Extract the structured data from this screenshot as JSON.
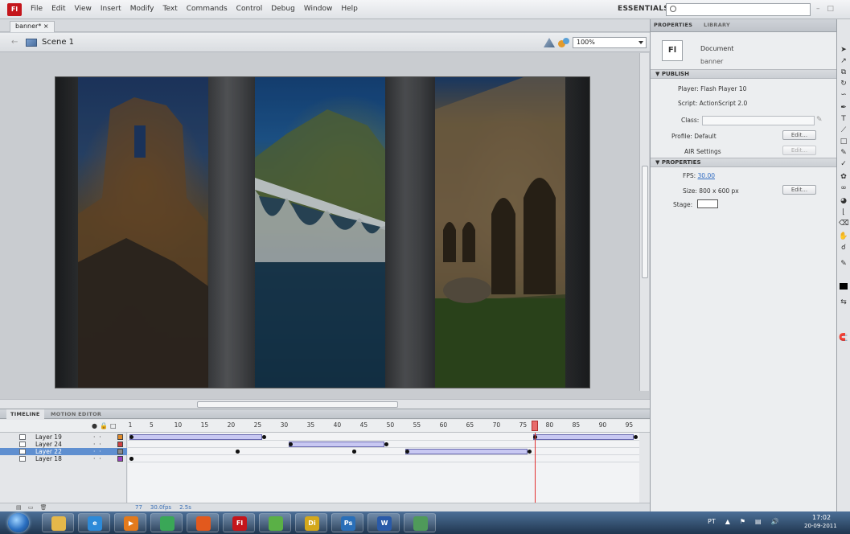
{
  "app": {
    "logo": "Fl"
  },
  "menu": [
    "File",
    "Edit",
    "View",
    "Insert",
    "Modify",
    "Text",
    "Commands",
    "Control",
    "Debug",
    "Window",
    "Help"
  ],
  "workspace": {
    "label": "ESSENTIALS ▾"
  },
  "search": {
    "placeholder": ""
  },
  "document_tab": {
    "label": "banner* ×"
  },
  "editbar": {
    "scene": "Scene 1",
    "zoom": "100%"
  },
  "stage": {
    "panels": [
      "castle ruin",
      "arch bridge over river",
      "stone abbey"
    ],
    "accent_colors": {
      "sky": "#1f5a94",
      "grass": "#2f4a22",
      "divider": "#4a4c4f"
    }
  },
  "timeline": {
    "tabs": [
      "TIMELINE",
      "MOTION EDITOR"
    ],
    "frame_labels": [
      "1",
      "5",
      "10",
      "15",
      "20",
      "25",
      "30",
      "35",
      "40",
      "45",
      "50",
      "55",
      "60",
      "65",
      "70",
      "75",
      "80",
      "85",
      "90",
      "95"
    ],
    "playhead_frame": 77,
    "layers": [
      {
        "name": "Layer 19",
        "color": "#e08a2a",
        "selected": false
      },
      {
        "name": "Layer 24",
        "color": "#d04040",
        "selected": false
      },
      {
        "name": "Layer 22",
        "color": "#8a8a8a",
        "selected": true
      },
      {
        "name": "Layer 18",
        "color": "#9b3fc0",
        "selected": false
      }
    ],
    "status": {
      "frame": "77",
      "fps": "30.0fps",
      "time": "2.5s"
    }
  },
  "properties": {
    "tabs": [
      "PROPERTIES",
      "LIBRARY"
    ],
    "doc_icon": "Fl",
    "doc_type": "Document",
    "doc_name": "banner",
    "publish_header": "PUBLISH",
    "player": "Player: Flash Player 10",
    "script": "Script: ActionScript 2.0",
    "class_label": "Class:",
    "profile": "Profile: Default",
    "edit_label": "Edit...",
    "air_settings": "AIR Settings",
    "properties_header": "PROPERTIES",
    "fps_label": "FPS:",
    "fps_value": "30.00",
    "size": "Size: 800 x 600 px",
    "stage_label": "Stage:"
  },
  "taskbar": {
    "apps": [
      {
        "name": "explorer",
        "color": "#e5b84a",
        "label": ""
      },
      {
        "name": "internet-explorer",
        "color": "#2d8ad8",
        "label": "e"
      },
      {
        "name": "media-player",
        "color": "#e37a1c",
        "label": "▶"
      },
      {
        "name": "chrome",
        "color": "#3aa757",
        "label": ""
      },
      {
        "name": "firefox",
        "color": "#e2591d",
        "label": ""
      },
      {
        "name": "flash",
        "color": "#c4161c",
        "label": "Fl"
      },
      {
        "name": "messenger",
        "color": "#5ab046",
        "label": ""
      },
      {
        "name": "director",
        "color": "#d4a81b",
        "label": "Di"
      },
      {
        "name": "photoshop",
        "color": "#2a6fb8",
        "label": "Ps"
      },
      {
        "name": "word",
        "color": "#2a5aa8",
        "label": "W"
      },
      {
        "name": "people",
        "color": "#4f9a5a",
        "label": ""
      }
    ],
    "language": "PT",
    "time": "17:02",
    "date": "20-09-2011"
  }
}
